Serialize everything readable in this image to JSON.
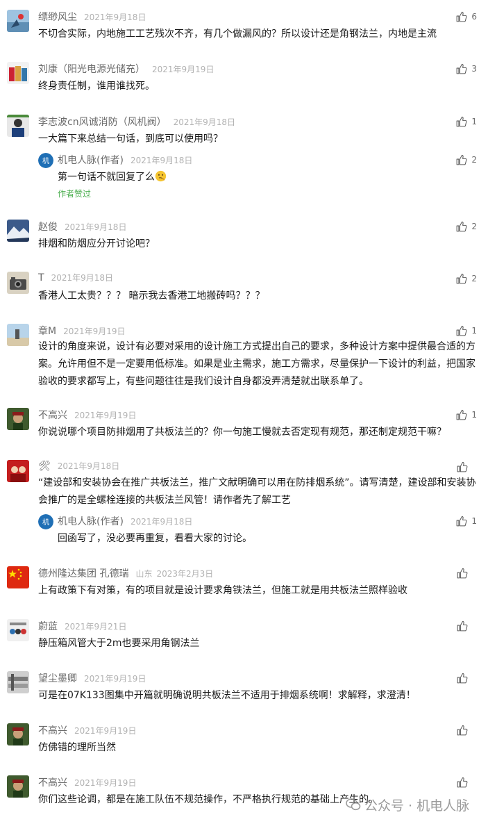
{
  "comments": [
    {
      "name": "缥缈风尘",
      "date": "2021年9月18日",
      "text": "不切合实际，内地施工工艺残次不齐，有几个做漏风的？所以设计还是角钢法兰，内地是主流",
      "likes": "6"
    },
    {
      "name": "刘康（阳光电源光储充）",
      "date": "2021年9月19日",
      "text": "终身责任制，谁用谁找死。",
      "likes": "3"
    },
    {
      "name": "李志波cn风诚消防（风机阀）",
      "date": "2021年9月18日",
      "text": "一大篇下来总结一句话，到底可以使用吗？",
      "likes": "1",
      "reply": {
        "name": "机电人脉(作者)",
        "date": "2021年9月18日",
        "text": "第一句话不就回复了么",
        "likes": "2",
        "badge": "作者赞过"
      }
    },
    {
      "name": "赵俊",
      "date": "2021年9月18日",
      "text": "排烟和防烟应分开讨论吧？",
      "likes": "2"
    },
    {
      "name": "T",
      "date": "2021年9月18日",
      "text": "香港人工太贵？？？ 暗示我去香港工地搬砖吗？？？",
      "likes": "2"
    },
    {
      "name": "章M",
      "date": "2021年9月19日",
      "text": "设计的角度来说，设计有必要对采用的设计施工方式提出自己的要求，多种设计方案中提供最合适的方案。允许用但不是一定要用低标准。如果是业主需求，施工方需求，尽量保护一下设计的利益，把国家验收的要求都写上，有些问题往往是我们设计自身都没弄清楚就出联系单了。",
      "likes": "1"
    },
    {
      "name": "不高兴",
      "date": "2021年9月19日",
      "text": "你说说哪个项目防排烟用了共板法兰的？你一句施工慢就去否定现有规范，那还制定规范干嘛？",
      "likes": "1"
    },
    {
      "name": "🛠",
      "date": "2021年9月18日",
      "text": "“建设部和安装协会在推广共板法兰，推广文献明确可以用在防排烟系统”。请写清楚，建设部和安装协会推广的是全螺栓连接的共板法兰风管！请作者先了解工艺",
      "likes": "",
      "reply": {
        "name": "机电人脉(作者)",
        "date": "2021年9月18日",
        "text": "回函写了，没必要再重复，看看大家的讨论。",
        "likes": "1",
        "badge": ""
      }
    },
    {
      "name": "德州隆达集团 孔德瑞",
      "location": "山东",
      "date": "2023年2月3日",
      "text": "上有政策下有对策，有的项目就是设计要求角铁法兰，但施工就是用共板法兰照样验收",
      "likes": ""
    },
    {
      "name": "蔚蓝",
      "date": "2021年9月21日",
      "text": "静压箱风管大于2m也要采用角钢法兰",
      "likes": ""
    },
    {
      "name": "望尘墨卿",
      "date": "2021年9月19日",
      "text": "可是在07K133图集中开篇就明确说明共板法兰不适用于排烟系统啊！求解释，求澄清！",
      "likes": ""
    },
    {
      "name": "不高兴",
      "date": "2021年9月19日",
      "text": "仿佛错的理所当然",
      "likes": ""
    },
    {
      "name": "不高兴",
      "date": "2021年9月19日",
      "text": "你们这些论调，都是在施工队伍不规范操作，不严格执行规范的基础上产生的。",
      "likes": ""
    }
  ],
  "watermark": {
    "text": "公众号 · 机电人脉"
  },
  "icons": {
    "like": "thumbs-up-icon",
    "watermark": "wechat-icon",
    "emoji": "thinking-face-icon"
  },
  "colors": {
    "name": "#6b6b6b",
    "date": "#b2b2b2",
    "text": "#1a1a1a",
    "badge": "#4caf50"
  }
}
